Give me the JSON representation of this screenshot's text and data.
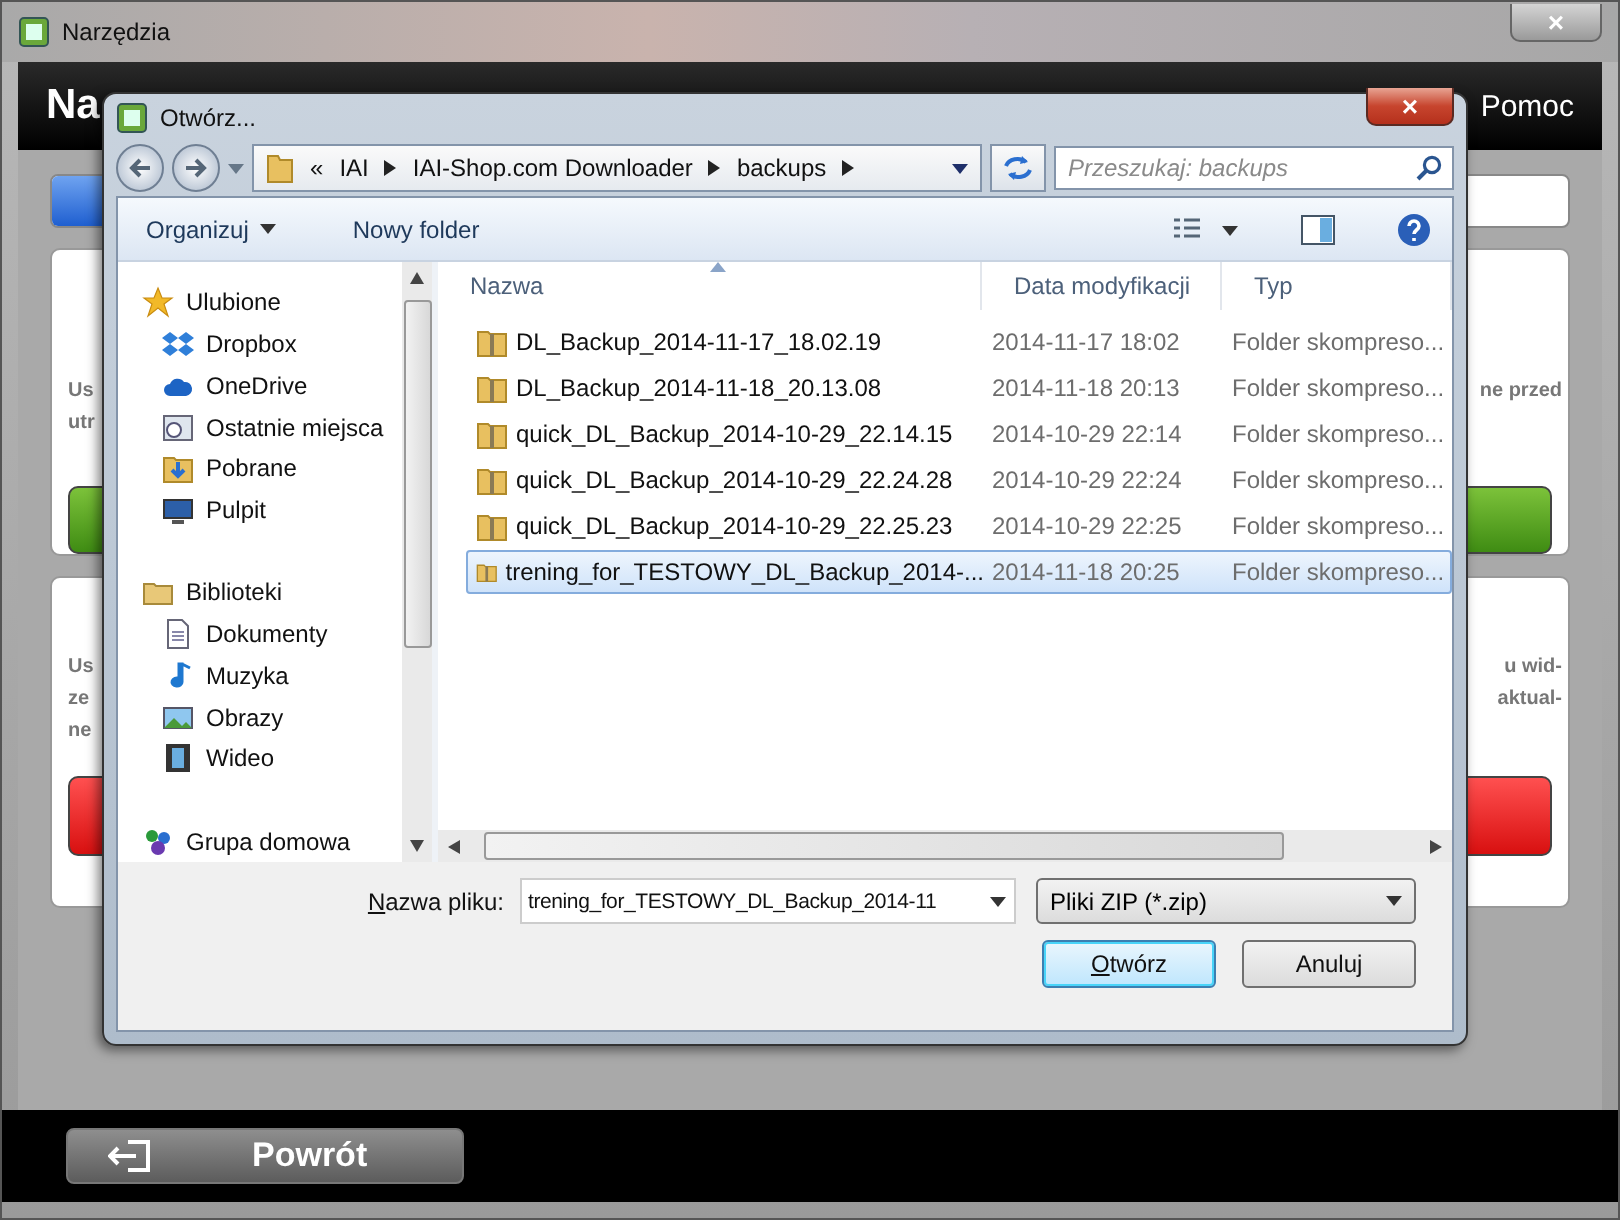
{
  "window": {
    "title": "Narzędzia",
    "close": "×"
  },
  "app": {
    "heading": "Na",
    "help": "Pomoc",
    "cards": [
      {
        "kind": "green",
        "left_lines": [
          "Us",
          "utr"
        ],
        "right_lines": [
          "ne przed"
        ]
      },
      {
        "kind": "red",
        "left_lines": [
          "Us",
          "ze",
          "ne"
        ],
        "right_lines": [
          "u wid-",
          "aktual-"
        ]
      }
    ],
    "back_button": "Powrót"
  },
  "dialog": {
    "title": "Otwórz...",
    "close": "×",
    "breadcrumb": {
      "overflow": "«",
      "parts": [
        "IAI",
        "IAI-Shop.com Downloader",
        "backups"
      ]
    },
    "search": {
      "placeholder": "Przeszukaj: backups"
    },
    "toolbar": {
      "organize": "Organizuj",
      "new_folder": "Nowy folder"
    },
    "nav": [
      {
        "label": "Ulubione",
        "kind": "star",
        "children": [
          {
            "label": "Dropbox",
            "kind": "dropbox"
          },
          {
            "label": "OneDrive",
            "kind": "cloud"
          },
          {
            "label": "Ostatnie miejsca",
            "kind": "recent"
          },
          {
            "label": "Pobrane",
            "kind": "download"
          },
          {
            "label": "Pulpit",
            "kind": "desktop"
          }
        ]
      },
      {
        "label": "Biblioteki",
        "kind": "library",
        "children": [
          {
            "label": "Dokumenty",
            "kind": "document"
          },
          {
            "label": "Muzyka",
            "kind": "music"
          },
          {
            "label": "Obrazy",
            "kind": "pictures"
          },
          {
            "label": "Wideo",
            "kind": "video"
          }
        ]
      },
      {
        "label": "Grupa domowa",
        "kind": "homegroup"
      }
    ],
    "columns": [
      {
        "label": "Nazwa",
        "sorted": true
      },
      {
        "label": "Data modyfikacji",
        "sorted": false
      },
      {
        "label": "Typ",
        "sorted": false
      }
    ],
    "rows": [
      {
        "name": "DL_Backup_2014-11-17_18.02.19",
        "date": "2014-11-17 18:02",
        "type": "Folder skompreso...",
        "selected": false
      },
      {
        "name": "DL_Backup_2014-11-18_20.13.08",
        "date": "2014-11-18 20:13",
        "type": "Folder skompreso...",
        "selected": false
      },
      {
        "name": "quick_DL_Backup_2014-10-29_22.14.15",
        "date": "2014-10-29 22:14",
        "type": "Folder skompreso...",
        "selected": false
      },
      {
        "name": "quick_DL_Backup_2014-10-29_22.24.28",
        "date": "2014-10-29 22:24",
        "type": "Folder skompreso...",
        "selected": false
      },
      {
        "name": "quick_DL_Backup_2014-10-29_22.25.23",
        "date": "2014-10-29 22:25",
        "type": "Folder skompreso...",
        "selected": false
      },
      {
        "name": "trening_for_TESTOWY_DL_Backup_2014-...",
        "date": "2014-11-18 20:25",
        "type": "Folder skompreso...",
        "selected": true
      }
    ],
    "filename": {
      "label": "Nazwa pliku:",
      "mnemonic": true,
      "value": "trening_for_TESTOWY_DL_Backup_2014-11"
    },
    "filter": "Pliki ZIP (*.zip)",
    "buttons": [
      {
        "label": "Otwórz",
        "default": true,
        "mnemonic": true
      },
      {
        "label": "Anuluj",
        "default": false
      }
    ]
  }
}
